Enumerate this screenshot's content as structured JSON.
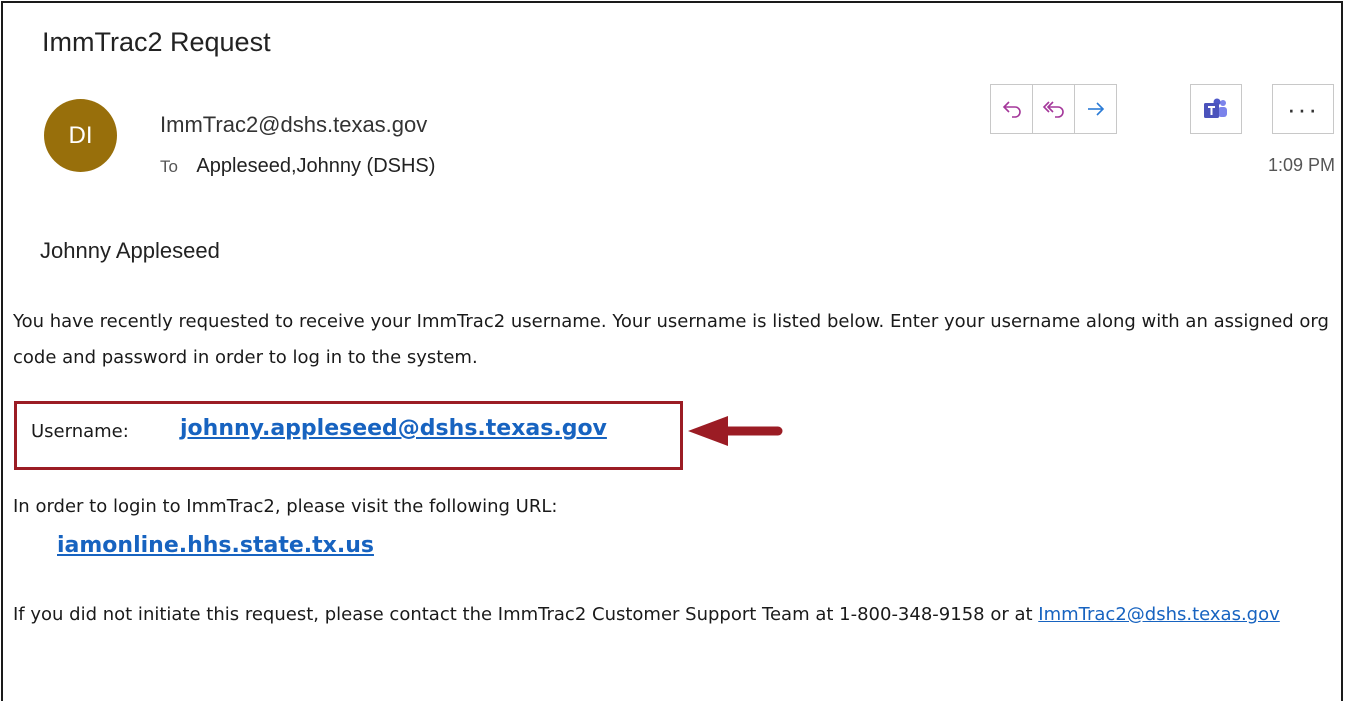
{
  "email": {
    "subject": "ImmTrac2 Request",
    "avatar_initials": "DI",
    "avatar_color": "#986f0b",
    "sender": "ImmTrac2@dshs.texas.gov",
    "to_label": "To",
    "recipient": "Appleseed,Johnny (DSHS)",
    "time": "1:09 PM"
  },
  "toolbar": {
    "icons": [
      "reply-icon",
      "reply-all-icon",
      "forward-icon",
      "teams-icon",
      "more-icon"
    ],
    "more_label": "···"
  },
  "message": {
    "greeting": "Johnny Appleseed",
    "para1": "You have recently requested to receive your ImmTrac2 username. Your username is listed below. Enter your username along with an assigned org code and password in order to log in to the system.",
    "username_label": "Username:",
    "username_value": "johnny.appleseed@dshs.texas.gov",
    "para2": "In order to login to ImmTrac2, please visit the following URL:",
    "url": "iamonline.hhs.state.tx.us",
    "para3_prefix": "If you did not initiate this request, please contact the ImmTrac2 Customer Support Team at 1-800-348-9158 or at ",
    "support_email": "ImmTrac2@dshs.texas.gov"
  },
  "colors": {
    "highlight": "#9b1c24",
    "link": "#1763c0"
  }
}
